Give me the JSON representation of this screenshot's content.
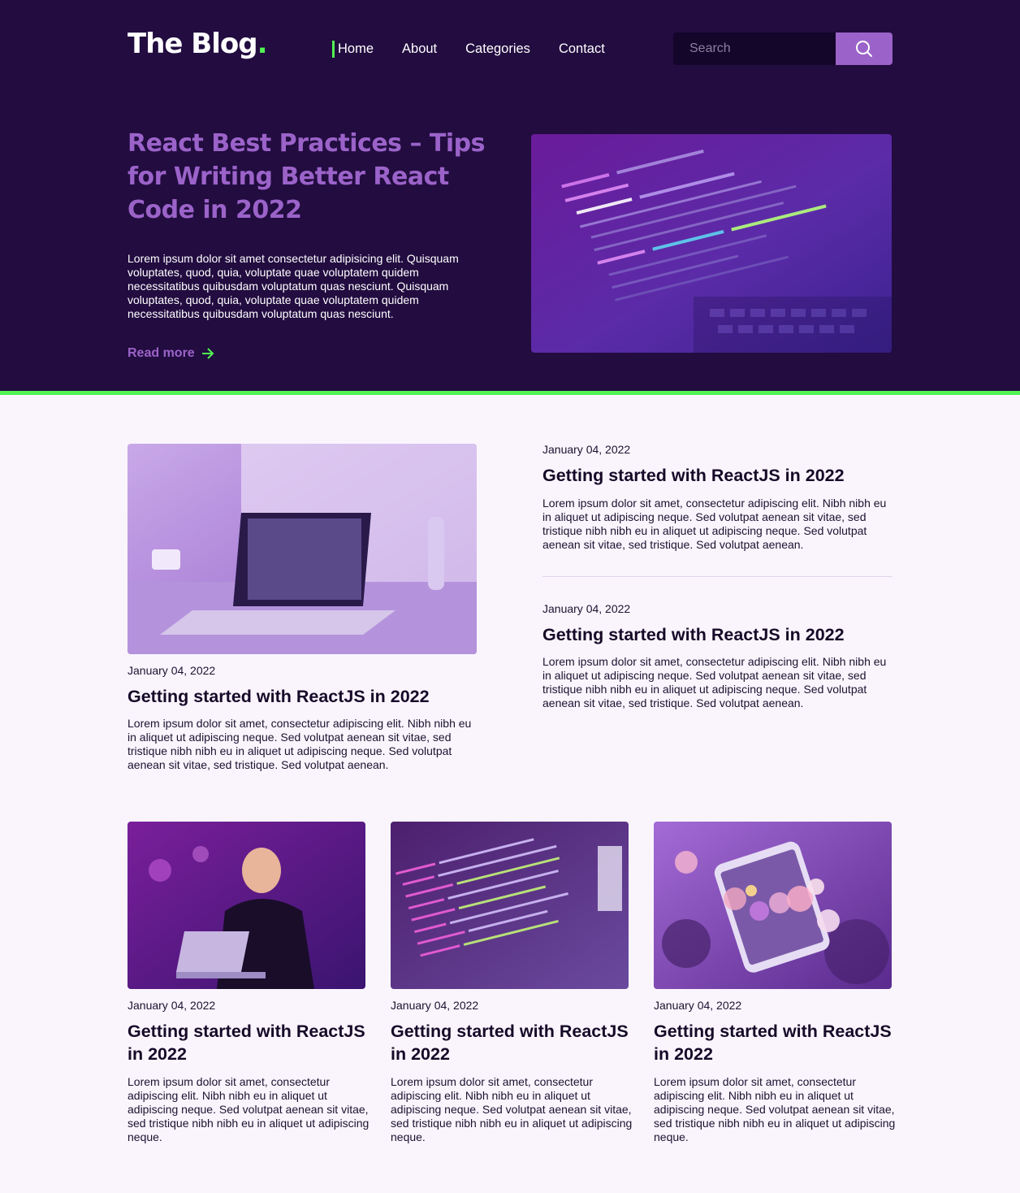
{
  "brand": {
    "logo_text": "The Blog",
    "logo_dot": ".",
    "accent_color": "#52f352",
    "primary_color": "#9b63c9",
    "header_bg": "#220c40"
  },
  "nav": {
    "items": [
      {
        "label": "Home",
        "active": true
      },
      {
        "label": "About"
      },
      {
        "label": "Categories"
      },
      {
        "label": "Contact"
      }
    ]
  },
  "search": {
    "placeholder": "Search",
    "button_icon": "search-icon"
  },
  "hero": {
    "title": "React Best Practices – Tips for Writing Better React Code in 2022",
    "text": "Lorem ipsum dolor sit amet consectetur adipisicing elit. Quisquam voluptates, quod, quia, voluptate quae voluptatem quidem necessitatibus quibusdam voluptatum quas nesciunt. Quisquam voluptates, quod, quia, voluptate quae voluptatem quidem necessitatibus quibusdam voluptatum quas nesciunt.",
    "read_more": "Read more",
    "read_more_icon": "arrow-right-icon"
  },
  "featured_post": {
    "date": "January 04, 2022",
    "title": "Getting started with ReactJS in 2022",
    "excerpt": "Lorem ipsum dolor sit amet, consectetur adipiscing elit. Nibh nibh eu in aliquet ut adipiscing neque. Sed volutpat aenean sit vitae, sed tristique nibh nibh eu in aliquet ut adipiscing neque. Sed volutpat aenean sit vitae, sed tristique. Sed volutpat aenean."
  },
  "side_posts": [
    {
      "date": "January 04, 2022",
      "title": "Getting started with ReactJS in 2022",
      "excerpt": "Lorem ipsum dolor sit amet, consectetur adipiscing elit. Nibh nibh eu in aliquet ut adipiscing neque. Sed volutpat aenean sit vitae, sed tristique nibh nibh eu in aliquet ut adipiscing neque. Sed volutpat aenean sit vitae, sed tristique. Sed volutpat aenean."
    },
    {
      "date": "January 04, 2022",
      "title": "Getting started with ReactJS in 2022",
      "excerpt": "Lorem ipsum dolor sit amet, consectetur adipiscing elit. Nibh nibh eu in aliquet ut adipiscing neque. Sed volutpat aenean sit vitae, sed tristique nibh nibh eu in aliquet ut adipiscing neque. Sed volutpat aenean sit vitae, sed tristique. Sed volutpat aenean."
    }
  ],
  "grid_posts": [
    {
      "date": "January 04, 2022",
      "title": "Getting started with ReactJS in 2022",
      "excerpt": "Lorem ipsum dolor sit amet, consectetur adipiscing elit. Nibh nibh eu in aliquet ut adipiscing neque. Sed volutpat aenean sit vitae, sed tristique nibh nibh eu in aliquet ut adipiscing neque."
    },
    {
      "date": "January 04, 2022",
      "title": "Getting started with ReactJS in 2022",
      "excerpt": "Lorem ipsum dolor sit amet, consectetur adipiscing elit. Nibh nibh eu in aliquet ut adipiscing neque. Sed volutpat aenean sit vitae, sed tristique nibh nibh eu in aliquet ut adipiscing neque."
    },
    {
      "date": "January 04, 2022",
      "title": "Getting started with ReactJS in 2022",
      "excerpt": "Lorem ipsum dolor sit amet, consectetur adipiscing elit. Nibh nibh eu in aliquet ut adipiscing neque. Sed volutpat aenean sit vitae, sed tristique nibh nibh eu in aliquet ut adipiscing neque."
    }
  ]
}
